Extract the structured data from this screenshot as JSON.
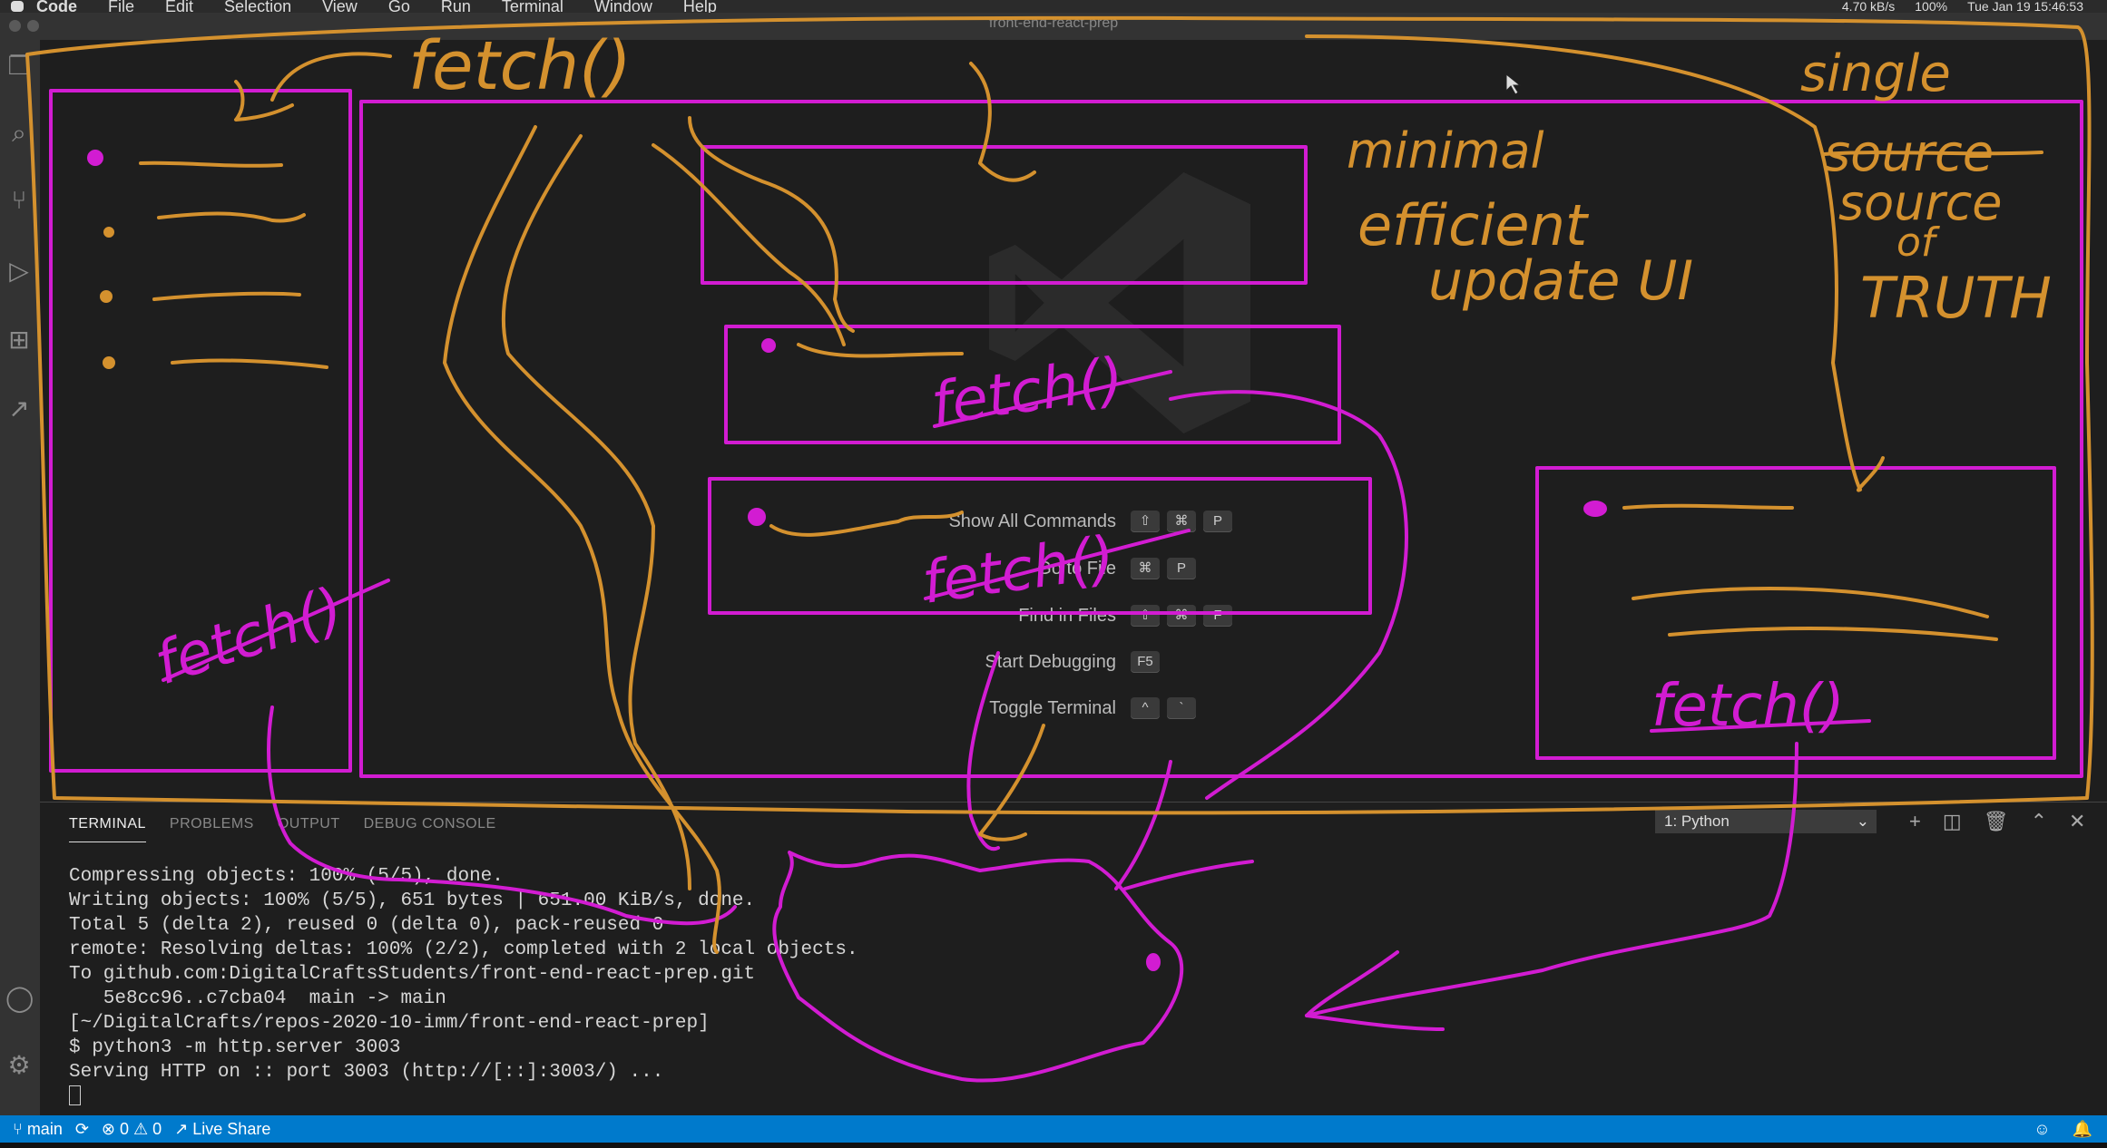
{
  "menubar": {
    "app": "Code",
    "items": [
      "File",
      "Edit",
      "Selection",
      "View",
      "Go",
      "Run",
      "Terminal",
      "Window",
      "Help"
    ],
    "network": "4.70 kB/s",
    "battery": "100%",
    "clock": "Tue Jan 19 15:46:53"
  },
  "window": {
    "title": "front-end-react-prep"
  },
  "welcome": {
    "commands": [
      {
        "label": "Show All Commands",
        "keys": [
          "⇧",
          "⌘",
          "P"
        ]
      },
      {
        "label": "Go to File",
        "keys": [
          "⌘",
          "P"
        ]
      },
      {
        "label": "Find in Files",
        "keys": [
          "⇧",
          "⌘",
          "F"
        ]
      },
      {
        "label": "Start Debugging",
        "keys": [
          "F5"
        ]
      },
      {
        "label": "Toggle Terminal",
        "keys": [
          "^",
          "`"
        ]
      }
    ]
  },
  "panel": {
    "tabs": [
      "TERMINAL",
      "PROBLEMS",
      "OUTPUT",
      "DEBUG CONSOLE"
    ],
    "terminal_select": "1: Python",
    "lines": [
      "Compressing objects: 100% (5/5), done.",
      "Writing objects: 100% (5/5), 651 bytes | 651.00 KiB/s, done.",
      "Total 5 (delta 2), reused 0 (delta 0), pack-reused 0",
      "remote: Resolving deltas: 100% (2/2), completed with 2 local objects.",
      "To github.com:DigitalCraftsStudents/front-end-react-prep.git",
      "   5e8cc96..c7cba04  main -> main",
      "[~/DigitalCrafts/repos-2020-10-imm/front-end-react-prep]",
      "$ python3 -m http.server 3003",
      "Serving HTTP on :: port 3003 (http://[::]:3003/) ..."
    ]
  },
  "statusbar": {
    "branch": "main",
    "errors": "0",
    "warnings": "0",
    "live_share": "Live Share"
  },
  "annotations": {
    "fetch_top": "fetch()",
    "fetch_mid": "fetch()",
    "fetch_lower": "fetch()",
    "fetch_left": "fetch()",
    "fetch_right": "fetch()",
    "minimal": "minimal",
    "efficient": "efficient",
    "update_ui": "update UI",
    "single": "single",
    "source_crossed": "source",
    "source": "source",
    "of": "of",
    "truth": "TRUTH"
  },
  "colors": {
    "orange_ink": "#d4912e",
    "magenta_ink": "#d21cd2",
    "statusbar": "#007acc"
  }
}
